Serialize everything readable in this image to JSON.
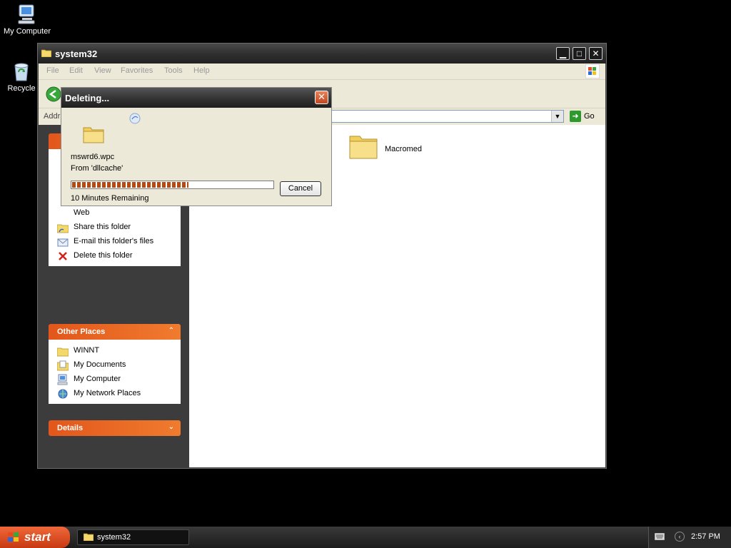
{
  "desktop": {
    "icons": [
      {
        "label": "My Computer",
        "icon": "my-computer-icon"
      },
      {
        "label": "Recycle",
        "icon": "recycle-bin-icon"
      }
    ]
  },
  "window": {
    "title": "system32",
    "menu": [
      "File",
      "Edit",
      "View",
      "Favorites",
      "Tools",
      "Help"
    ],
    "address_label": "Addr",
    "go_label": "Go",
    "tasks_panel": {
      "items": [
        "Web",
        "Share this folder",
        "E-mail this folder's files",
        "Delete this folder"
      ]
    },
    "other_places": {
      "title": "Other Places",
      "items": [
        "WINNT",
        "My Documents",
        "My Computer",
        "My Network Places"
      ]
    },
    "details": {
      "title": "Details"
    },
    "files": [
      {
        "name": "Macromed",
        "icon": "folder-icon"
      }
    ]
  },
  "dialog": {
    "title": "Deleting...",
    "file_name": "mswrd6.wpc",
    "from": "From 'dllcache'",
    "progress_percent": 58,
    "remaining": "10 Minutes Remaining",
    "cancel_label": "Cancel"
  },
  "taskbar": {
    "start_label": "start",
    "task_item": "system32",
    "clock": "2:57 PM"
  },
  "colors": {
    "panel_header": "#e2571b",
    "progress_fill": "#b54a12",
    "desktop": "#000000"
  }
}
